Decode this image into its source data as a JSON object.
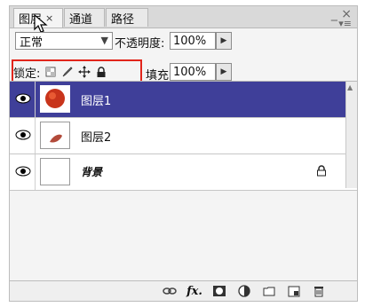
{
  "tabs": [
    {
      "label": "图层",
      "active": true,
      "close": "×"
    },
    {
      "label": "通道"
    },
    {
      "label": "路径"
    }
  ],
  "panel_controls": {
    "minimize": "_ ×",
    "menu": "▾≡"
  },
  "blend_mode": {
    "value": "正常"
  },
  "opacity": {
    "label": "不透明度:",
    "value": "100%"
  },
  "lock": {
    "label": "锁定:"
  },
  "fill": {
    "label": "填充:",
    "value": "100%"
  },
  "layers": [
    {
      "name": "图层1",
      "selected": true
    },
    {
      "name": "图层2",
      "selected": false
    },
    {
      "name": "背景",
      "selected": false,
      "locked": true
    }
  ],
  "bottom_icons": [
    "link-layers-icon",
    "fx-icon",
    "add-mask-icon",
    "adjustment-icon",
    "group-folder-icon",
    "new-layer-icon",
    "trash-icon"
  ],
  "colors": {
    "selection": "#3f3f99",
    "highlight": "#e1251b"
  }
}
